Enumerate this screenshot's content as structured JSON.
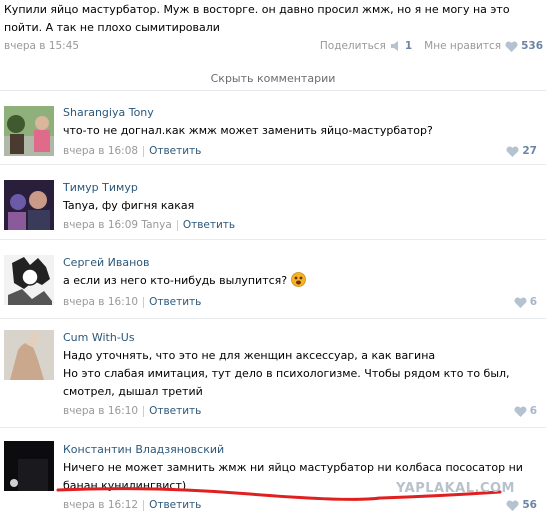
{
  "post": {
    "text": "Купили яйцо мастурбатор. Муж в восторге. он давно просил жмж, но я не могу на это пойти. А так не плохо сымитировали",
    "date": "вчера в 15:45",
    "share_label": "Поделиться",
    "share_count": "1",
    "like_label": "Мне нравится",
    "like_count": "536"
  },
  "hide_comments_label": "Скрыть комментарии",
  "comments": [
    {
      "author": "Sharangiya Tony",
      "text": "что-то не догнал.как жмж может заменить яйцо-мастурбатор?",
      "date": "вчера в 16:08",
      "reply_label": "Ответить",
      "likes": "27"
    },
    {
      "author": "Тимур Тимур",
      "text": "Tanya, фу фигня какая",
      "date": "вчера в 16:09 Tanya",
      "reply_label": "Ответить",
      "likes": ""
    },
    {
      "author": "Сергей Иванов",
      "text": "а если из него кто-нибудь вылупится?",
      "date": "вчера в 16:10",
      "reply_label": "Ответить",
      "likes": "6"
    },
    {
      "author": "Cum With-Us",
      "text_line1": "Надо уточнять, что это не для женщин аксессуар, а как вагина",
      "text_line2": "Но это слабая имитация, тут дело в психологизме. Чтобы рядом кто то был, смотрел, дышал третий",
      "date": "вчера в 16:10",
      "reply_label": "Ответить",
      "likes": "6"
    },
    {
      "author": "Константин Владзяновский",
      "text": "Ничего не может замнить жмж ни яйцо мастурбатор ни колбаса пососатор ни банан кунилингвист)",
      "date": "вчера в 16:12",
      "reply_label": "Ответить",
      "likes": "56"
    }
  ],
  "watermark": "YAPLAKAL.COM",
  "colors": {
    "link": "#2b587a",
    "meta": "#999999",
    "like": "#6c85a6",
    "underline": "#e02020"
  },
  "icons": [
    "speaker-icon",
    "heart-icon",
    "emoji-icon"
  ]
}
